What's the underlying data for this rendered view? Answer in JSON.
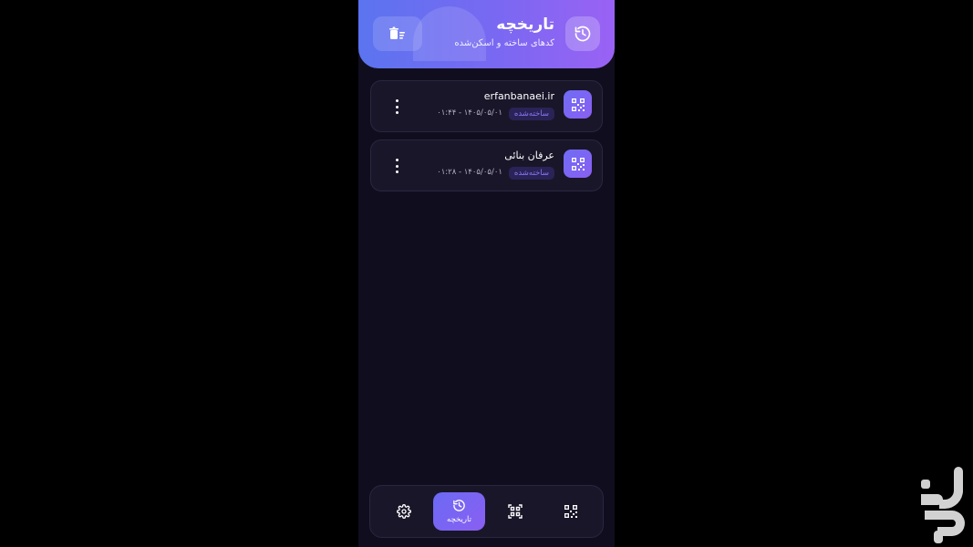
{
  "header": {
    "title": "تاریخچه",
    "subtitle": "کدهای ساخته و اسکن‌شده",
    "clear_icon": "clear-all-icon",
    "history_icon": "history-icon"
  },
  "items": [
    {
      "name": "erfanbanaei.ir",
      "badge": "ساخته‌شده",
      "date": "۰۱:۴۴ - ۱۴۰۵/۰۵/۰۱"
    },
    {
      "name": "عرفان بنائی",
      "badge": "ساخته‌شده",
      "date": "۰۱:۲۸ - ۱۴۰۵/۰۵/۰۱"
    }
  ],
  "nav": {
    "settings_icon": "settings-icon",
    "history_label": "تاریخچه",
    "scan_icon": "qr-scan-icon",
    "create_icon": "qr-code-icon"
  },
  "colors": {
    "background": "#100e1e",
    "accent": "#7a68f2",
    "card": "#191629",
    "badge_text": "#8c78f5"
  }
}
